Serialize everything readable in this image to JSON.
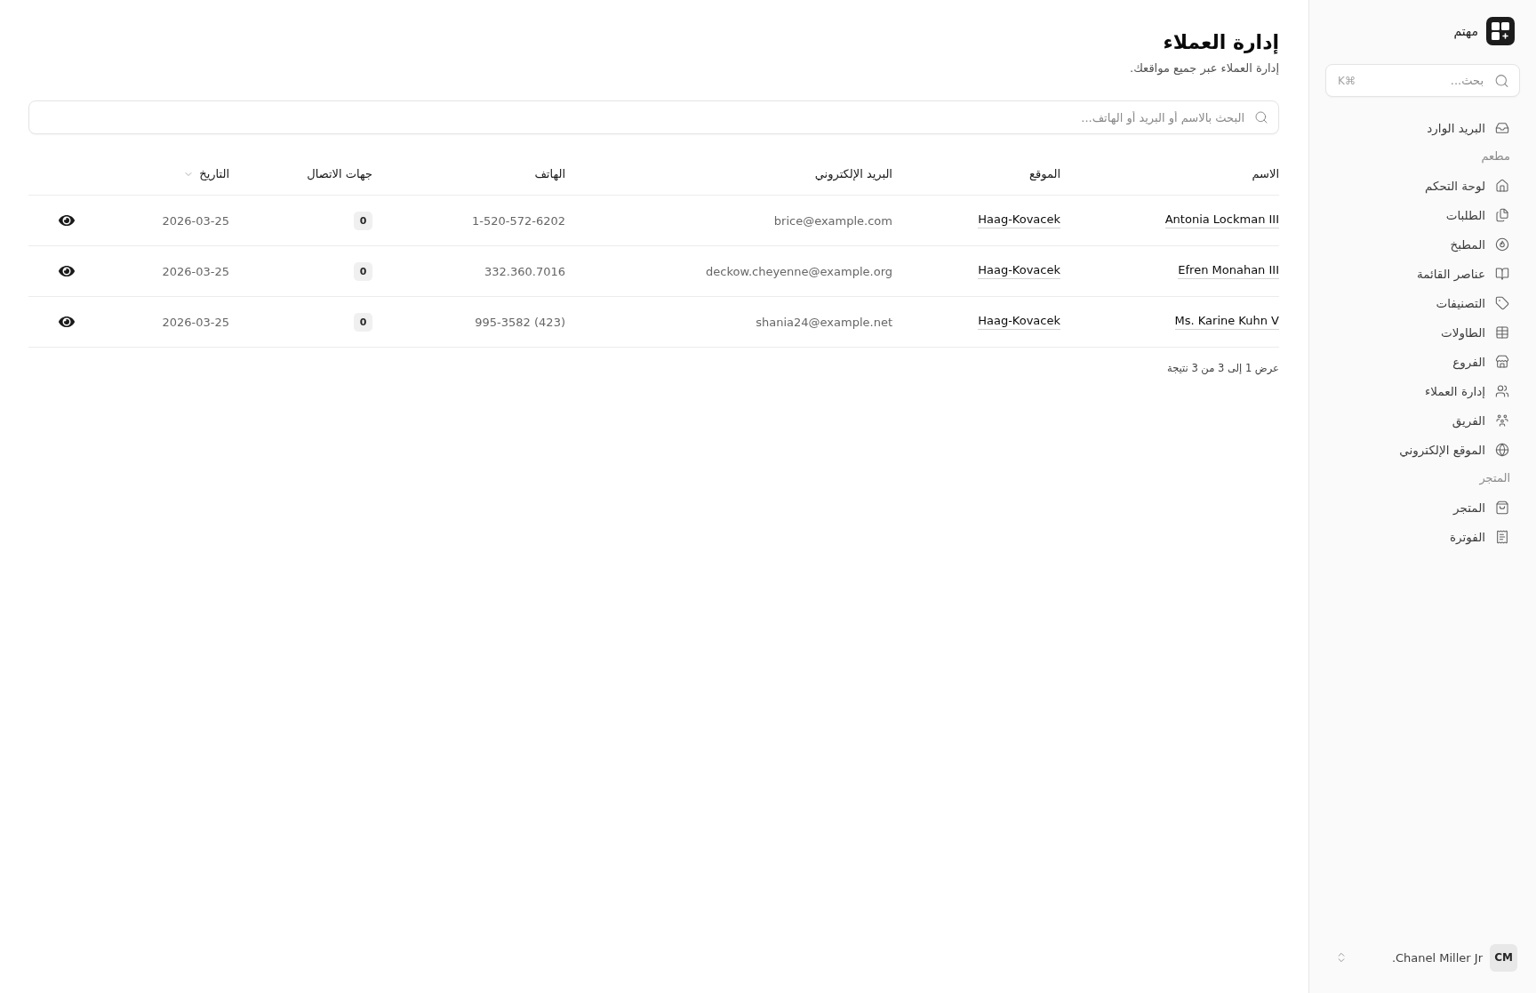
{
  "sidebar": {
    "brand": {
      "name": "مهتم"
    },
    "search": {
      "placeholder": "بحث...",
      "shortcut": "⌘K"
    },
    "nav": [
      {
        "kind": "item",
        "label": "البريد الوارد",
        "selected": false
      },
      {
        "kind": "section",
        "label": "مطعم"
      },
      {
        "kind": "item",
        "label": "لوحة التحكم",
        "selected": false
      },
      {
        "kind": "item",
        "label": "الطلبات",
        "selected": false
      },
      {
        "kind": "item",
        "label": "المطبخ",
        "selected": false
      },
      {
        "kind": "item",
        "label": "عناصر القائمة",
        "selected": false
      },
      {
        "kind": "item",
        "label": "التصنيفات",
        "selected": false
      },
      {
        "kind": "item",
        "label": "الطاولات",
        "selected": false
      },
      {
        "kind": "item",
        "label": "الفروع",
        "selected": false
      },
      {
        "kind": "item",
        "label": "إدارة العملاء",
        "selected": false
      },
      {
        "kind": "item",
        "label": "الفريق",
        "selected": false
      },
      {
        "kind": "item",
        "label": "الموقع الإلكتروني",
        "selected": false
      },
      {
        "kind": "section",
        "label": "المتجر"
      },
      {
        "kind": "item",
        "label": "المتجر",
        "selected": false
      },
      {
        "kind": "item",
        "label": "الفوترة",
        "selected": false
      }
    ],
    "user": {
      "name": "Chanel Miller Jr.",
      "initials": "CM"
    }
  },
  "page": {
    "title": "إدارة العملاء",
    "subtitle": "إدارة العملاء عبر جميع مواقعك."
  },
  "search": {
    "placeholder": "البحث بالاسم أو البريد أو الهاتف..."
  },
  "table": {
    "columns": [
      {
        "label": "الاسم",
        "sorted": false
      },
      {
        "label": "الموقع",
        "sorted": false
      },
      {
        "label": "البريد الإلكتروني",
        "sorted": false
      },
      {
        "label": "الهاتف",
        "sorted": false
      },
      {
        "label": "جهات الاتصال",
        "sorted": false
      },
      {
        "label": "التاريخ",
        "sorted": true
      }
    ],
    "rows": [
      {
        "name": "Antonia Lockman III",
        "location": "Haag-Kovacek",
        "email": "brice@example.com",
        "phone": "1-520-572-6202",
        "contacts": "0",
        "date": "2026-03-25"
      },
      {
        "name": "Efren Monahan III",
        "location": "Haag-Kovacek",
        "email": "deckow.cheyenne@example.org",
        "phone": "332.360.7016",
        "contacts": "0",
        "date": "2026-03-25"
      },
      {
        "name": "Ms. Karine Kuhn V",
        "location": "Haag-Kovacek",
        "email": "shania24@example.net",
        "phone": "(423) 995-3582",
        "contacts": "0",
        "date": "2026-03-25"
      }
    ],
    "footer": "عرض 1 إلى 3 من 3 نتيجة"
  }
}
